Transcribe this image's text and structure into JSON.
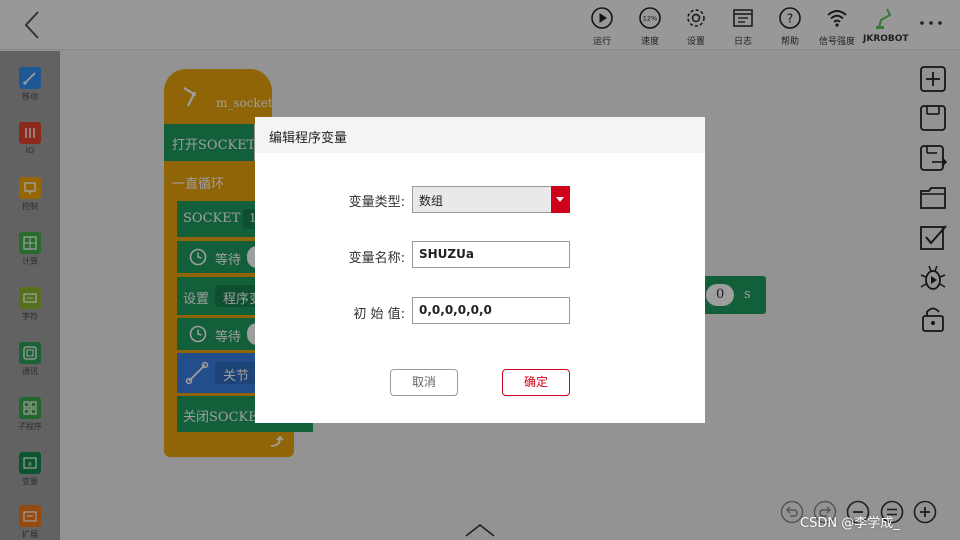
{
  "toolbar": {
    "items": [
      {
        "label": "运行",
        "icon": "play-icon"
      },
      {
        "label": "速度",
        "icon": "speed-gauge-icon",
        "badge": "12%"
      },
      {
        "label": "设置",
        "icon": "gear-icon"
      },
      {
        "label": "日志",
        "icon": "log-icon"
      },
      {
        "label": "帮助",
        "icon": "help-icon"
      },
      {
        "label": "信号强度",
        "icon": "wifi-icon"
      },
      {
        "label": "JKROBOT",
        "icon": "robot-arm-icon"
      }
    ]
  },
  "palette": {
    "items": [
      {
        "label": "移动",
        "color": "#2f8ef0"
      },
      {
        "label": "IO",
        "color": "#e0442a"
      },
      {
        "label": "控制",
        "color": "#f0a30a"
      },
      {
        "label": "计算",
        "color": "#3fae4a"
      },
      {
        "label": "字符",
        "color": "#8bb42a"
      },
      {
        "label": "通讯",
        "color": "#2e9f5a"
      },
      {
        "label": "子程序",
        "color": "#3aa64a"
      },
      {
        "label": "变量",
        "color": "#138a4e"
      },
      {
        "label": "扩展",
        "color": "#f07a1a"
      }
    ]
  },
  "workspace": {
    "hat_label": "m_socket",
    "open_socket": "打开SOCKET",
    "loop": "一直循环",
    "socket_row": "SOCKET",
    "socket_value": "1",
    "wait1": "等待",
    "set_var": "设置",
    "set_var_slot": "程序变",
    "wait2": "等待",
    "close_joint": "关节",
    "close_socket": "关闭SOCKET",
    "seconds_value": "0",
    "seconds_unit": "s"
  },
  "dialog": {
    "title": "编辑程序变量",
    "type_label": "变量类型:",
    "type_value": "数组",
    "name_label": "变量名称:",
    "name_value": "SHUZUa",
    "init_label": "初 始 值:",
    "init_value": "0,0,0,0,0,0",
    "cancel": "取消",
    "ok": "确定"
  },
  "watermark": "CSDN @李学成_",
  "colors": {
    "accent": "#d0021b",
    "block_green": "#1d9a5c",
    "block_yellow": "#e8a40c",
    "block_blue": "#3a7fe0"
  }
}
